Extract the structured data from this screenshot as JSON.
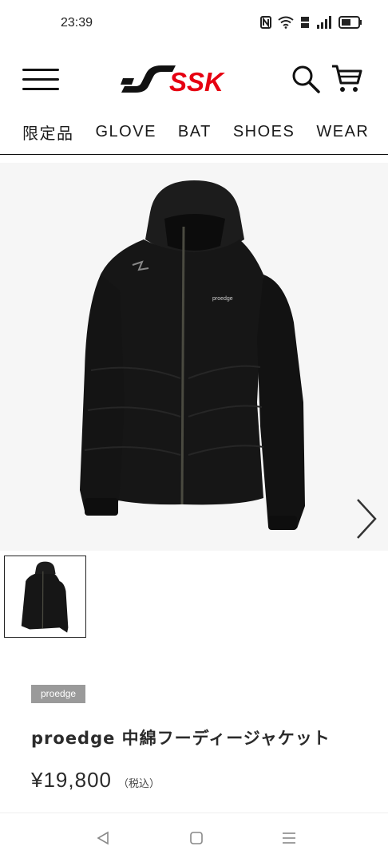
{
  "status_bar": {
    "time": "23:39",
    "icons": [
      "nfc-icon",
      "wifi-icon",
      "volte-icon",
      "signal-icon",
      "battery-icon"
    ]
  },
  "header": {
    "logo_text": "SSK",
    "icons": [
      "menu-icon",
      "search-icon",
      "cart-icon"
    ]
  },
  "category_nav": {
    "items": [
      "限定品",
      "GLOVE",
      "BAT",
      "SHOES",
      "WEAR"
    ]
  },
  "gallery": {
    "next_icon": "chevron-right-icon",
    "jacket_print": "proedge"
  },
  "product": {
    "brand": "proedge",
    "title": "proedge 中綿フーディージャケット",
    "price": "¥19,800",
    "tax_note": "（税込）"
  },
  "system_nav": {
    "icons": [
      "back-icon",
      "home-icon",
      "recents-icon"
    ]
  },
  "colors": {
    "accent": "#e60012",
    "nav_bar": "#0d0d0d",
    "badge": "#9a9a9a"
  }
}
